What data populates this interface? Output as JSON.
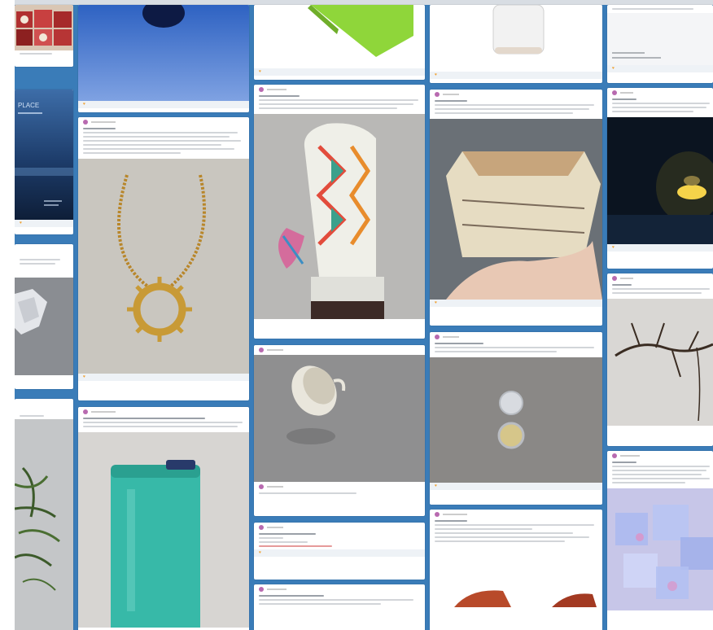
{
  "colors": {
    "board_background": "#3a7cb8",
    "card_background": "#ffffff",
    "card_footer": "#eef2f6",
    "like_accent": "#f0a030",
    "avatar": "#b86ab0",
    "link_red": "#e69a9a"
  },
  "icons": {
    "like": "heart-icon",
    "avatar": "avatar-icon"
  },
  "heart_glyph": "♥",
  "poster_lettering": "PLACE"
}
